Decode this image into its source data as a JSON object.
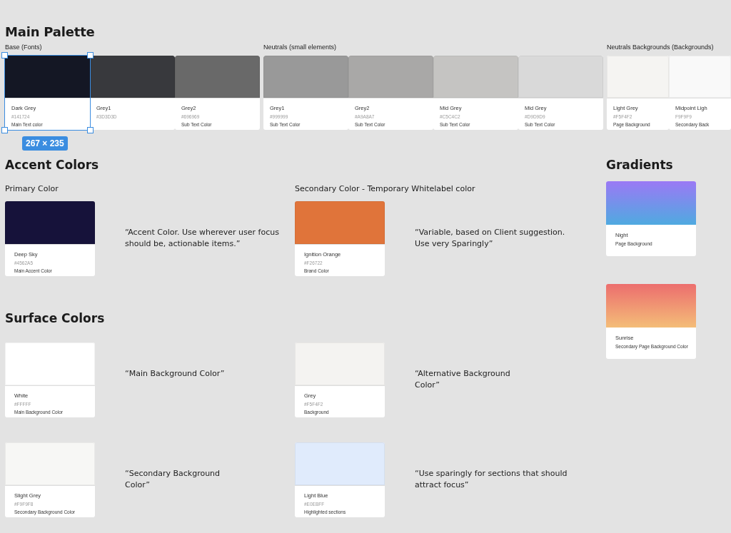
{
  "palette": {
    "title": "Main Palette",
    "groups": [
      {
        "label": "Base (Fonts)",
        "swatches": [
          {
            "name": "Dark Grey",
            "hex": "#141724",
            "usage": "Main Text color",
            "color": "#141724",
            "selected": true,
            "size": "267 × 235"
          },
          {
            "name": "Grey1",
            "hex": "#3D3D3D",
            "color": "#38393d",
            "selected": false
          },
          {
            "name": "Grey2",
            "hex": "#696969",
            "usage": "Sub Text Color",
            "color": "#696969",
            "selected": false
          }
        ]
      },
      {
        "label": "Neutrals (small elements)",
        "swatches": [
          {
            "name": "Grey1",
            "hex": "#999999",
            "usage": "Sub Text Color",
            "color": "#999999",
            "selected": false
          },
          {
            "name": "Grey2",
            "hex": "#A9A8A7",
            "usage": "Sub Text Color",
            "color": "#a9a8a7",
            "selected": false
          },
          {
            "name": "Mid Grey",
            "hex": "#C5C4C2",
            "usage": "Sub Text Color",
            "color": "#c5c4c2",
            "selected": false
          },
          {
            "name": "Mid Grey",
            "hex": "#D9D9D9",
            "usage": "Sub Text Color",
            "color": "#d9d9d9",
            "selected": false
          }
        ]
      },
      {
        "label": "Neutrals Backgrounds (Backgrounds)",
        "swatches": [
          {
            "name": "Light Grey",
            "hex": "#F5F4F2",
            "usage": "Page Background",
            "color": "#f5f4f2",
            "selected": false
          },
          {
            "name": "Midpoint Ligh",
            "hex": "F9F9F9",
            "usage": "Secondary Back",
            "color": "#f9f9f9",
            "selected": false
          }
        ]
      }
    ]
  },
  "accent": {
    "title": "Accent Colors",
    "items": [
      {
        "label": "Primary Color",
        "card": {
          "name": "Deep Sky",
          "hex": "#4562A5",
          "usage": "Main Accent Color",
          "color": "#16123a"
        },
        "note": "“Accent Color. Use wherever user focus should be, actionable items.”"
      },
      {
        "label": "Secondary Color - Temporary Whitelabel color",
        "card": {
          "name": "Ignition Orange",
          "hex": "#F26722",
          "usage": "Brand Color",
          "color": "#e0743a"
        },
        "note": "“Variable, based on Client suggestion. Use very Sparingly”"
      }
    ]
  },
  "surface": {
    "title": "Surface Colors",
    "items": [
      {
        "card": {
          "name": "White",
          "hex": "#FFFFF",
          "usage": "Main Background Color",
          "color": "#ffffff"
        },
        "note": "“Main Background Color”"
      },
      {
        "card": {
          "name": "Grey",
          "hex": "#F5F4F2",
          "usage": "Background",
          "color": "#f4f3f1"
        },
        "note": "“Alternative Background Color”"
      },
      {
        "card": {
          "name": "Slight Grey",
          "hex": "#F9F9F8",
          "usage": "Secondary Background Color",
          "color": "#f7f7f5"
        },
        "note": "“Secondary Background Color”"
      },
      {
        "card": {
          "name": "Light Blue",
          "hex": "#E0EBFF",
          "usage": "Highlighted sections",
          "color": "#e0ebfc"
        },
        "note": "“Use sparingly for sections that should attract focus”"
      }
    ]
  },
  "gradients": {
    "title": "Gradients",
    "items": [
      {
        "name": "Night",
        "usage": "Page Background",
        "kind": "night"
      },
      {
        "name": "Sunrise",
        "usage": "Secondary Page Background Color",
        "kind": "sunrise"
      }
    ]
  }
}
